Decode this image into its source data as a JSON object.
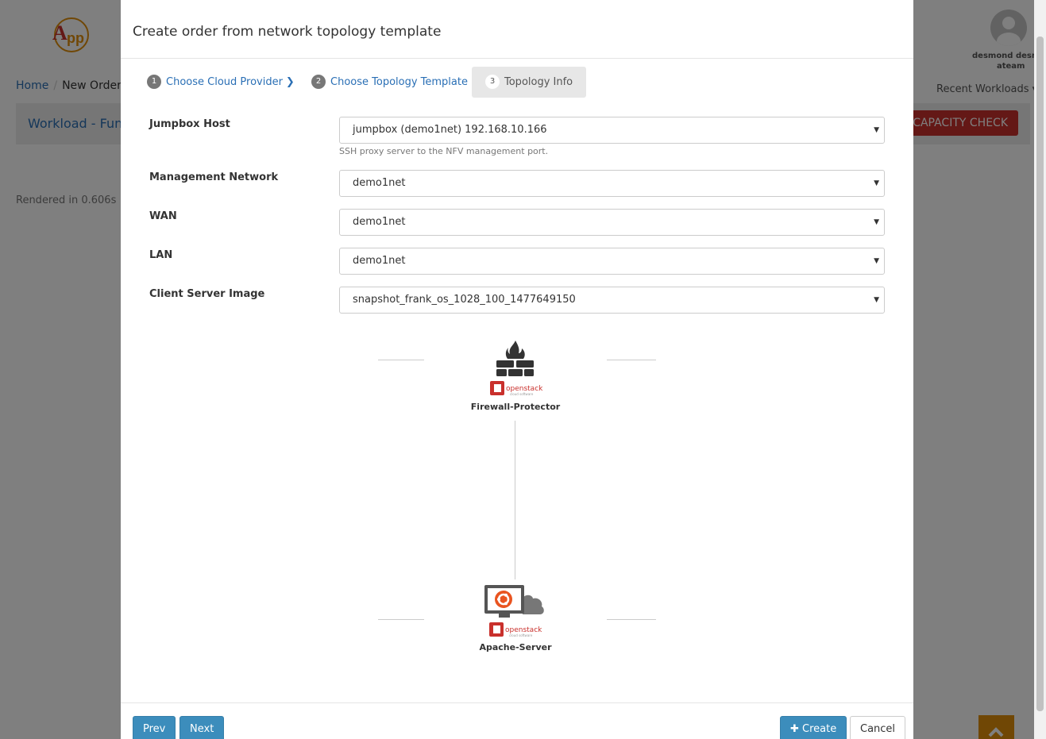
{
  "background": {
    "breadcrumb": {
      "home": "Home",
      "current": "New Order"
    },
    "workload_title": "Workload - Funny",
    "capacity_check": "CAPACITY CHECK",
    "rendered": "Rendered in 0.606s",
    "user": {
      "name": "desmond desmo",
      "team": "ateam"
    },
    "recent_workloads": "Recent Workloads ▾"
  },
  "modal": {
    "title": "Create order from network topology template",
    "steps": [
      {
        "num": "1",
        "label": "Choose Cloud Provider"
      },
      {
        "num": "2",
        "label": "Choose Topology Template"
      },
      {
        "num": "3",
        "label": "Topology Info"
      }
    ],
    "fields": {
      "jumpbox": {
        "label": "Jumpbox Host",
        "value": "jumpbox (demo1net) 192.168.10.166",
        "help": "SSH proxy server to the NFV management port."
      },
      "mgmt": {
        "label": "Management Network",
        "value": "demo1net"
      },
      "wan": {
        "label": "WAN",
        "value": "demo1net"
      },
      "lan": {
        "label": "LAN",
        "value": "demo1net"
      },
      "image": {
        "label": "Client Server Image",
        "value": "snapshot_frank_os_1028_100_1477649150"
      }
    },
    "topology": {
      "firewall": "Firewall-Protector",
      "server": "Apache-Server",
      "brand": "openstack"
    },
    "buttons": {
      "prev": "Prev",
      "next": "Next",
      "create": "Create",
      "cancel": "Cancel"
    }
  },
  "colors": {
    "link": "#2a6fb5",
    "primary": "#3c8dbc",
    "danger": "#c9302c",
    "accent": "#e08e0b"
  }
}
